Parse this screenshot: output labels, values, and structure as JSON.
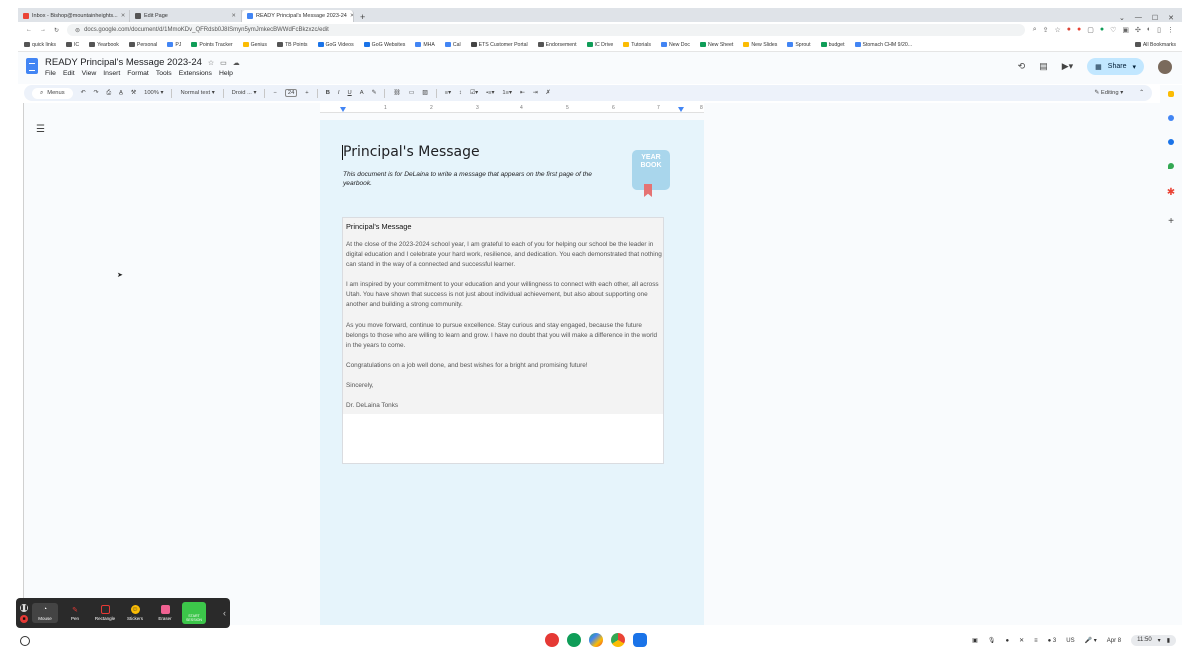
{
  "browser": {
    "tabs": [
      {
        "label": "Inbox - Bishop@mountainheights...",
        "color": "#ea4335",
        "active": false
      },
      {
        "label": "Edit Page",
        "color": "#555555",
        "active": false
      },
      {
        "label": "READY Principal's Message 2023-24",
        "color": "#4285f4",
        "active": true
      }
    ],
    "new_tab": "+",
    "url": "docs.google.com/document/d/1MmoKDv_QFRdsb0J8ISmyn5ymJmkecBWWdFcBkzxzc/edit",
    "bookmarks": [
      "quick links",
      "IC",
      "Yearbook",
      "Personal",
      "PJ",
      "Points Tracker",
      "Genius",
      "TB Points",
      "GoG Videos",
      "GoG Websites",
      "MHA",
      "Cal",
      "ETS Customer Portal",
      "Endorsement",
      "IC Drive",
      "Tutorials",
      "New Doc",
      "New Sheet",
      "New Slides",
      "Sprout",
      "budget",
      "Stomach CHM 9/20..."
    ],
    "all_bookmarks": "All Bookmarks"
  },
  "doc": {
    "title": "READY Principal's Message 2023-24",
    "menu": [
      "File",
      "Edit",
      "View",
      "Insert",
      "Format",
      "Tools",
      "Extensions",
      "Help"
    ],
    "share_label": "Share",
    "toolbar": {
      "menus_label": "Menus",
      "zoom": "100%",
      "style": "Normal text",
      "font": "Droid ...",
      "font_size": "24",
      "mode": "Editing"
    },
    "ruler_ticks": [
      "1",
      "2",
      "3",
      "4",
      "5",
      "6",
      "7",
      "8"
    ]
  },
  "page": {
    "title": "Principal's Message",
    "subtitle": "This document is for DeLaina to write a message that appears on the first page of the yearbook.",
    "badge_text": "YEAR BOOK",
    "card": {
      "title": "Principal's Message",
      "paragraphs": [
        "At the close of the 2023-2024 school year, I am grateful to each of you for helping our school be the leader in digital education and I celebrate your hard work, resilience, and dedication. You each demonstrated that nothing can stand in the way of a connected and successful learner.",
        "I am inspired by your commitment to your education and your willingness to connect with each other, all across Utah. You have shown that success is not just about individual achievement, but also about supporting one another and building a strong community.",
        "As you move forward, continue to pursue excellence. Stay curious and stay engaged, because the future belongs to those who are willing to learn and grow. I have no doubt that you will make a difference in the world in the years to come.",
        "Congratulations on a job well done, and best wishes for a bright and promising future!",
        "Sincerely,",
        "Dr. DeLaina Tonks"
      ]
    }
  },
  "pen_toolbar": {
    "tools": [
      "Mouse",
      "Pen",
      "Rectangle",
      "Stickers",
      "Eraser"
    ],
    "start_label": "START SESSION"
  },
  "shelf": {
    "keyboard": "US",
    "date": "Apr 8",
    "time": "11:50"
  }
}
